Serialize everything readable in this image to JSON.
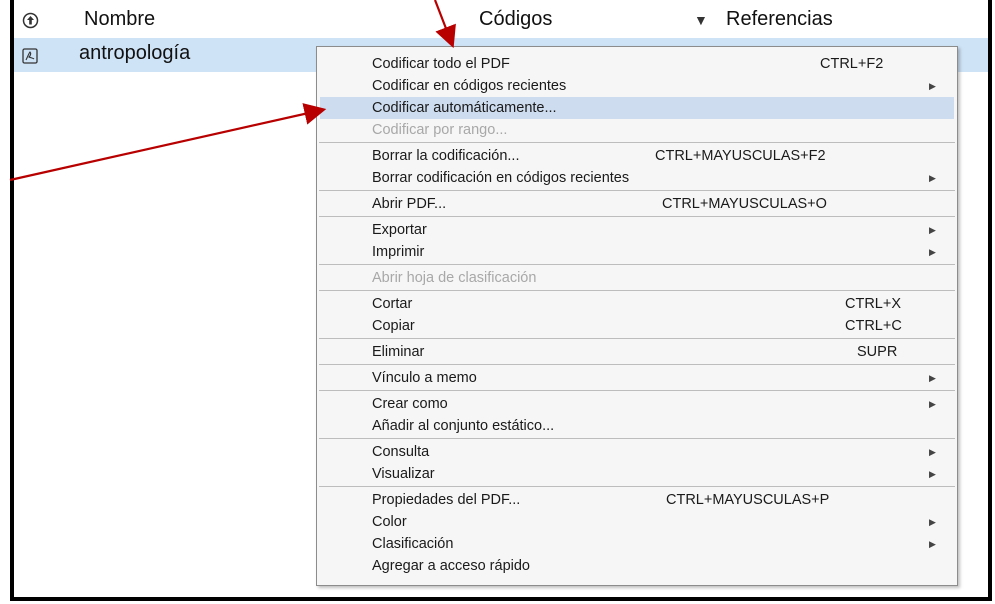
{
  "header": {
    "col_name": "Nombre",
    "col_codes": "Códigos",
    "col_refs": "Referencias"
  },
  "row": {
    "name": "antropología"
  },
  "menu": {
    "items": [
      {
        "label": "Codificar todo el PDF",
        "shortcut": "CTRL+F2"
      },
      {
        "label": "Codificar en códigos recientes",
        "submenu": true
      },
      {
        "label": "Codificar automáticamente...",
        "highlighted": true
      },
      {
        "label": "Codificar por rango...",
        "disabled": true
      },
      {
        "label": "Borrar la codificación...",
        "shortcut": "CTRL+MAYUSCULAS+F2"
      },
      {
        "label": "Borrar codificación en códigos recientes",
        "submenu": true
      },
      {
        "label": "Abrir PDF...",
        "shortcut": "CTRL+MAYUSCULAS+O"
      },
      {
        "label": "Exportar",
        "submenu": true
      },
      {
        "label": "Imprimir",
        "submenu": true
      },
      {
        "label": "Abrir hoja de clasificación",
        "disabled": true
      },
      {
        "label": "Cortar",
        "shortcut": "CTRL+X"
      },
      {
        "label": "Copiar",
        "shortcut": "CTRL+C"
      },
      {
        "label": "Eliminar",
        "shortcut": "SUPR"
      },
      {
        "label": "Vínculo a memo",
        "submenu": true
      },
      {
        "label": "Crear como",
        "submenu": true
      },
      {
        "label": "Añadir al conjunto estático..."
      },
      {
        "label": "Consulta",
        "submenu": true
      },
      {
        "label": "Visualizar",
        "submenu": true
      },
      {
        "label": "Propiedades del PDF...",
        "shortcut": "CTRL+MAYUSCULAS+P"
      },
      {
        "label": "Color",
        "submenu": true
      },
      {
        "label": "Clasificación",
        "submenu": true
      },
      {
        "label": "Agregar a acceso rápido"
      }
    ]
  },
  "colors": {
    "selection": "#cfe3f7",
    "menu_highlight": "#cddcee",
    "annotation_arrow": "#b80000"
  },
  "icons": {
    "sort_icon": "circle-arrow-icon",
    "file_icon": "pdf-icon",
    "submenu_icon": "triangle-right-icon"
  }
}
